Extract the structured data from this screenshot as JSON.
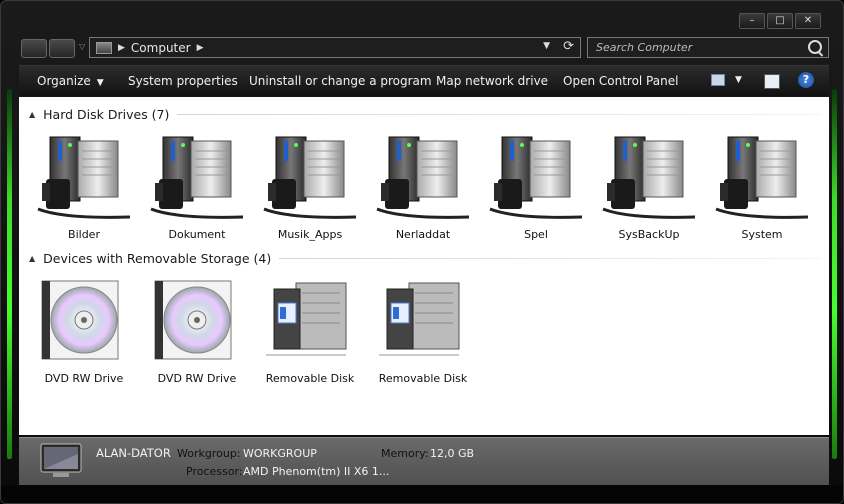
{
  "window": {
    "caption_buttons": {
      "minimize": "–",
      "maximize": "□",
      "close": "✕"
    }
  },
  "navbar": {
    "address_text": "Computer",
    "search_placeholder": "Search Computer"
  },
  "toolbar": {
    "organize": "Organize",
    "system_properties": "System properties",
    "uninstall": "Uninstall or change a program",
    "map_drive": "Map network drive",
    "control_panel": "Open Control Panel",
    "help_symbol": "?"
  },
  "groups": {
    "hard_disks": {
      "title": "Hard Disk Drives (7)",
      "items": [
        "Bilder",
        "Dokument",
        "Musik_Apps",
        "Nerladdat",
        "Spel",
        "SysBackUp",
        "System"
      ]
    },
    "removable": {
      "title": "Devices with Removable Storage (4)",
      "items": [
        "DVD RW Drive",
        "DVD RW Drive",
        "Removable Disk",
        "Removable Disk"
      ]
    }
  },
  "status": {
    "computer_name": "ALAN-DATOR",
    "workgroup_label": "Workgroup:",
    "workgroup_value": "WORKGROUP",
    "memory_label": "Memory:",
    "memory_value": "12,0 GB",
    "processor_label": "Processor:",
    "processor_value": "AMD Phenom(tm) II X6 1..."
  },
  "colors": {
    "accent_glow": "#46ff2c",
    "chrome_dark": "#121212",
    "content_bg": "#ffffff"
  }
}
